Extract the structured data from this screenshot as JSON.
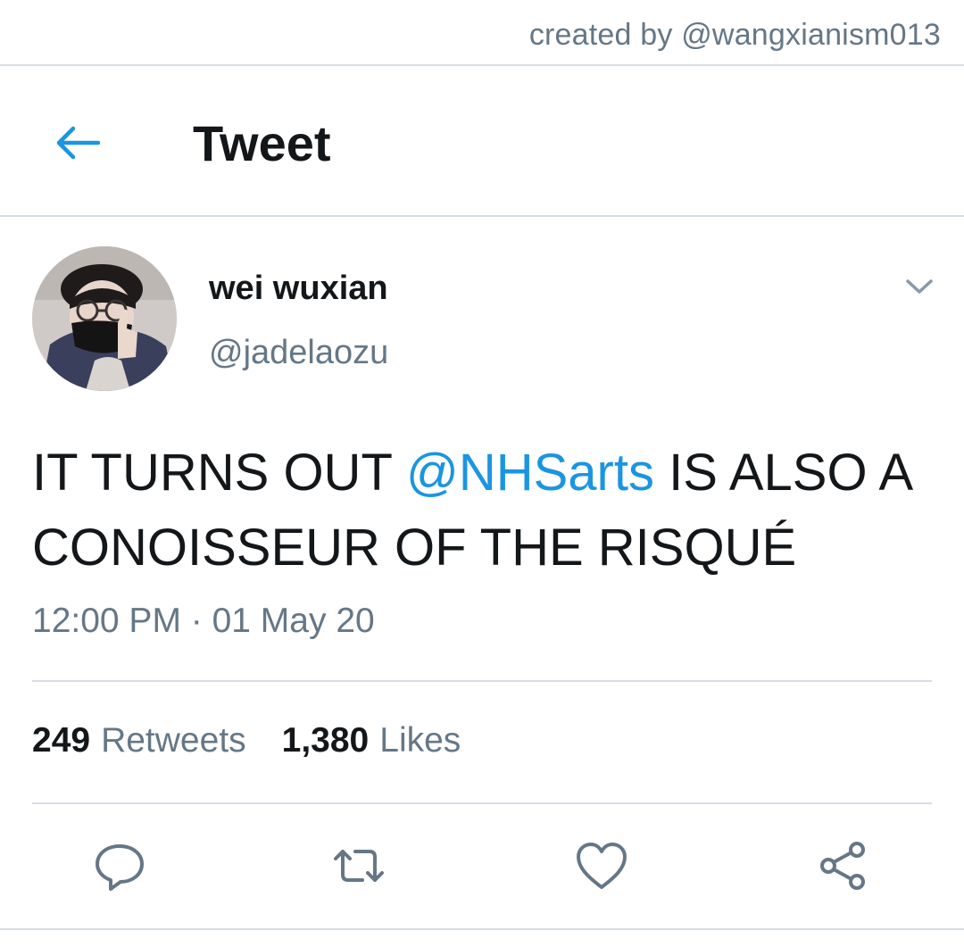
{
  "watermark": {
    "text": "created by @wangxianism013"
  },
  "header": {
    "title": "Tweet",
    "back_icon": "arrow-left-icon"
  },
  "author": {
    "display_name": "wei wuxian",
    "handle": "@jadelaozu",
    "avatar": "profile-photo",
    "menu_icon": "chevron-down-icon"
  },
  "tweet": {
    "text_before": "IT TURNS OUT ",
    "mention": "@NHSarts",
    "text_after": " IS ALSO A CONOISSEUR OF THE RISQUÉ",
    "timestamp": "12:00 PM · 01 May 20"
  },
  "stats": {
    "retweets_count": "249",
    "retweets_label": "Retweets",
    "likes_count": "1,380",
    "likes_label": "Likes"
  },
  "actions": [
    "reply-icon",
    "retweet-icon",
    "heart-icon",
    "share-icon"
  ],
  "colors": {
    "accent": "#1b95e0",
    "muted": "#657786",
    "text": "#14171a",
    "divider": "#d6dde3"
  }
}
